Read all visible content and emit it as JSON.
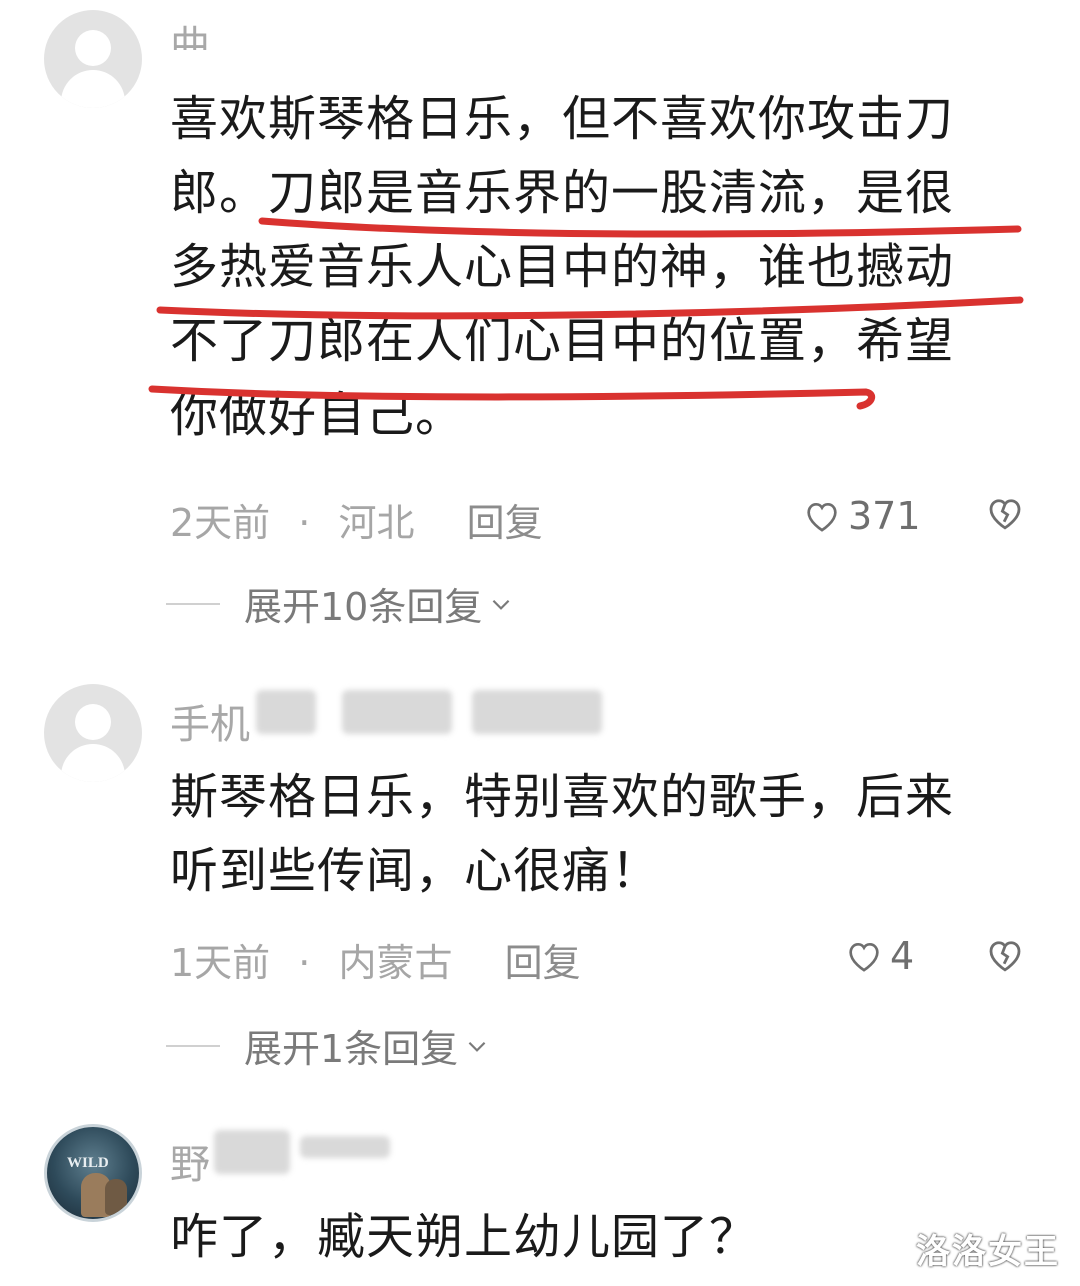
{
  "comments": [
    {
      "username": "曲",
      "text_lines": [
        "喜欢斯琴格日乐，但不喜欢你攻击刀",
        "郎。刀郎是音乐界的一股清流，是很",
        "多热爱音乐人心目中的神，谁也撼动",
        "不了刀郎在人们心目中的位置，希望",
        "你做好自己。"
      ],
      "time": "2天前",
      "location": "河北",
      "reply_label": "回复",
      "likes": "371",
      "expand_label": "展开10条回复"
    },
    {
      "username": "手机",
      "text_lines": [
        "斯琴格日乐，特别喜欢的歌手，后来",
        "听到些传闻，心很痛！"
      ],
      "time": "1天前",
      "location": "内蒙古",
      "reply_label": "回复",
      "likes": "4",
      "expand_label": "展开1条回复"
    },
    {
      "username": "野",
      "avatar_text": "WILD",
      "text_lines": [
        "咋了，臧天朔上幼儿园了？"
      ]
    }
  ],
  "separator": "·",
  "watermark": "洛洛女王",
  "colors": {
    "highlight_underline": "#d9322f",
    "text": "#1a1a1a",
    "meta": "#a6a6a6"
  },
  "icons": [
    "heart-icon",
    "broken-heart-icon",
    "chevron-down-icon"
  ]
}
